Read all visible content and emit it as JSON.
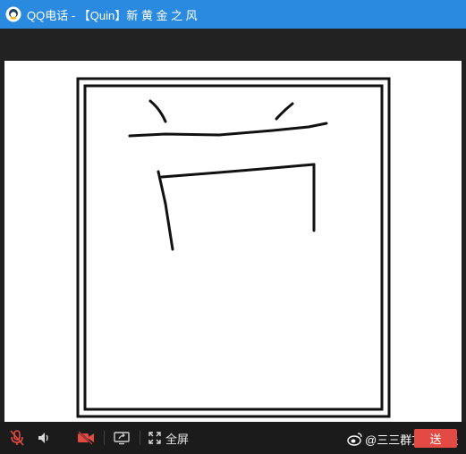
{
  "window": {
    "title": "QQ电话 - 【Quin】新 黄 金 之 风",
    "app_icon": "qq-penguin-icon"
  },
  "controls": {
    "mic_icon": "mic-muted-icon",
    "speaker_icon": "speaker-icon",
    "camera_icon": "camera-off-icon",
    "share_icon": "screen-share-icon",
    "fullscreen_icon": "fullscreen-icon",
    "fullscreen_label": "全屏"
  },
  "watermark": {
    "icon": "weibo-icon",
    "text": "@三三群文献推送"
  },
  "send_button": {
    "label": "送"
  },
  "colors": {
    "titlebar": "#2a8ae0",
    "muted_red": "#e24a43",
    "background": "#1f1f1f"
  }
}
